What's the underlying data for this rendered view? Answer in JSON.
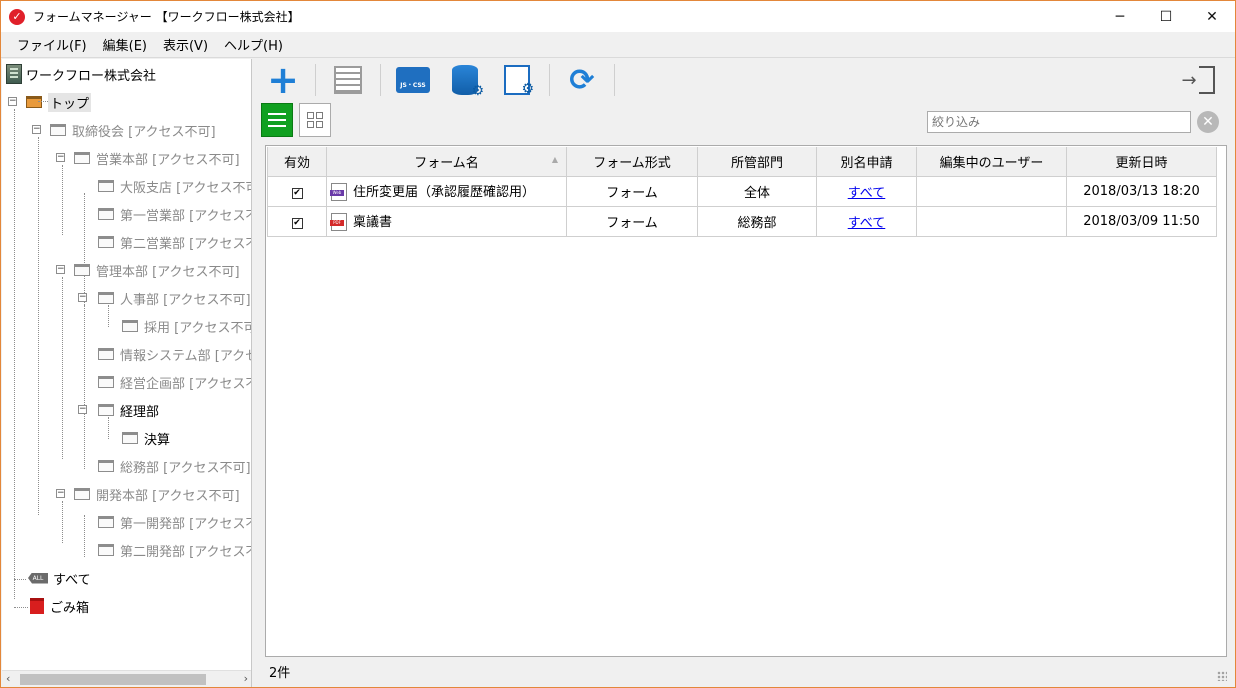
{
  "window": {
    "title": "フォームマネージャー 【ワークフロー株式会社】",
    "controls": [
      "─",
      "☐",
      "✕"
    ]
  },
  "menu": [
    {
      "label": "ファイル(F)"
    },
    {
      "label": "編集(E)"
    },
    {
      "label": "表示(V)"
    },
    {
      "label": "ヘルプ(H)"
    }
  ],
  "tree": {
    "root_label": "ワークフロー株式会社",
    "nodes": [
      {
        "label": "トップ"
      },
      {
        "label": "取締役会 [アクセス不可]"
      },
      {
        "label": "営業本部 [アクセス不可]"
      },
      {
        "label": "大阪支店 [アクセス不可]"
      },
      {
        "label": "第一営業部 [アクセス不可]"
      },
      {
        "label": "第二営業部 [アクセス不可]"
      },
      {
        "label": "管理本部 [アクセス不可]"
      },
      {
        "label": "人事部 [アクセス不可]"
      },
      {
        "label": "採用 [アクセス不可]"
      },
      {
        "label": "情報システム部 [アクセス不可]"
      },
      {
        "label": "経営企画部 [アクセス不可]"
      },
      {
        "label": "経理部"
      },
      {
        "label": "決算"
      },
      {
        "label": "総務部 [アクセス不可]"
      },
      {
        "label": "開発本部 [アクセス不可]"
      },
      {
        "label": "第一開発部 [アクセス不可]"
      },
      {
        "label": "第二開発部 [アクセス不可]"
      },
      {
        "label": "すべて",
        "badge": "ALL"
      },
      {
        "label": "ごみ箱"
      }
    ]
  },
  "toolbar": {
    "jscss_label": "JS・CSS"
  },
  "filter": {
    "placeholder": "絞り込み"
  },
  "table": {
    "columns": [
      "有効",
      "フォーム名",
      "フォーム形式",
      "所管部門",
      "別名申請",
      "編集中のユーザー",
      "更新日時"
    ],
    "rows": [
      {
        "enabled": "✔",
        "type_tag": "Web",
        "name": "住所変更届（承認履歴確認用）",
        "format": "フォーム",
        "department": "全体",
        "alias": "すべて",
        "editor": "",
        "updated": "2018/03/13 18:20"
      },
      {
        "enabled": "✔",
        "type_tag": "PDF",
        "name": "稟議書",
        "format": "フォーム",
        "department": "総務部",
        "alias": "すべて",
        "editor": "",
        "updated": "2018/03/09 11:50"
      }
    ]
  },
  "status": {
    "count": "2件"
  },
  "colors": {
    "accent": "#1f7fd6",
    "frame": "#e3873a",
    "active_view": "#10a020"
  }
}
